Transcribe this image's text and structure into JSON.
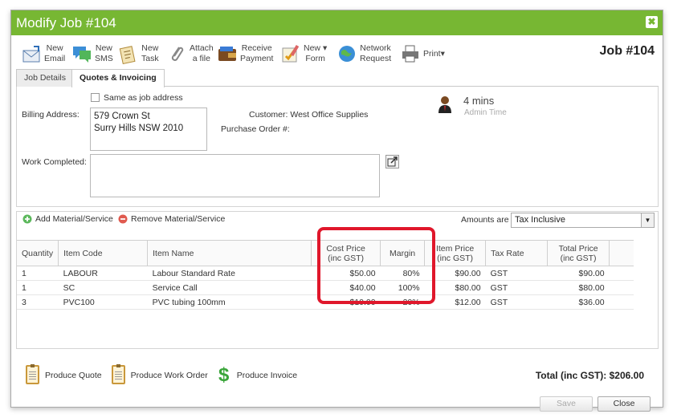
{
  "window": {
    "title": "Modify Job #104",
    "close_glyph": "✖"
  },
  "toolbar": {
    "buttons": [
      {
        "icon": "email-icon",
        "label1": "New",
        "label2": "Email"
      },
      {
        "icon": "sms-icon",
        "label1": "New",
        "label2": "SMS"
      },
      {
        "icon": "task-icon",
        "label1": "New",
        "label2": "Task"
      },
      {
        "icon": "paperclip-icon",
        "label1": "Attach",
        "label2": "a file"
      },
      {
        "icon": "wallet-icon",
        "label1": "Receive",
        "label2": "Payment"
      },
      {
        "icon": "form-icon",
        "label1": "New",
        "label2": "Form",
        "dropdown": "▾"
      },
      {
        "icon": "globe-icon",
        "label1": "Network",
        "label2": "Request"
      },
      {
        "icon": "printer-icon",
        "label1": "Print",
        "dropdown": "▾"
      }
    ],
    "job_number": "Job #104"
  },
  "tabs": [
    {
      "label": "Job Details",
      "active": false
    },
    {
      "label": "Quotes & Invoicing",
      "active": true
    }
  ],
  "form": {
    "same_as_job_address": "Same as job address",
    "billing_address_label": "Billing Address:",
    "billing_address_line1": "579 Crown St",
    "billing_address_line2": "Surry Hills NSW 2010",
    "customer_label": "Customer:",
    "customer_value": "West Office Supplies",
    "purchase_order_label": "Purchase Order #:",
    "admin_time_value": "4 mins",
    "admin_time_label": "Admin Time",
    "work_completed_label": "Work Completed:"
  },
  "grid": {
    "add_label": "Add Material/Service",
    "remove_label": "Remove Material/Service",
    "amounts_label": "Amounts are",
    "amounts_value": "Tax Inclusive",
    "columns": [
      {
        "l1": "Quantity",
        "l2": ""
      },
      {
        "l1": "Item Code",
        "l2": ""
      },
      {
        "l1": "Item Name",
        "l2": ""
      },
      {
        "l1": "Cost Price",
        "l2": "(inc GST)"
      },
      {
        "l1": "Margin",
        "l2": ""
      },
      {
        "l1": "Item Price",
        "l2": "(inc GST)"
      },
      {
        "l1": "Tax Rate",
        "l2": ""
      },
      {
        "l1": "Total Price",
        "l2": "(inc GST)"
      }
    ],
    "rows": [
      {
        "qty": "1",
        "code": "LABOUR",
        "name": "Labour Standard Rate",
        "cost": "$50.00",
        "margin": "80%",
        "price": "$90.00",
        "tax": "GST",
        "total": "$90.00"
      },
      {
        "qty": "1",
        "code": "SC",
        "name": "Service Call",
        "cost": "$40.00",
        "margin": "100%",
        "price": "$80.00",
        "tax": "GST",
        "total": "$80.00"
      },
      {
        "qty": "3",
        "code": "PVC100",
        "name": "PVC tubing 100mm",
        "cost": "$10.00",
        "margin": "20%",
        "price": "$12.00",
        "tax": "GST",
        "total": "$36.00"
      }
    ]
  },
  "footer": {
    "produce_quote": "Produce Quote",
    "produce_work_order": "Produce Work Order",
    "produce_invoice": "Produce Invoice",
    "total": "Total (inc GST): $206.00",
    "save": "Save",
    "close": "Close"
  },
  "colors": {
    "title_bar": "#77b733",
    "highlight": "#e0172b",
    "dollar": "#3aa53a"
  }
}
